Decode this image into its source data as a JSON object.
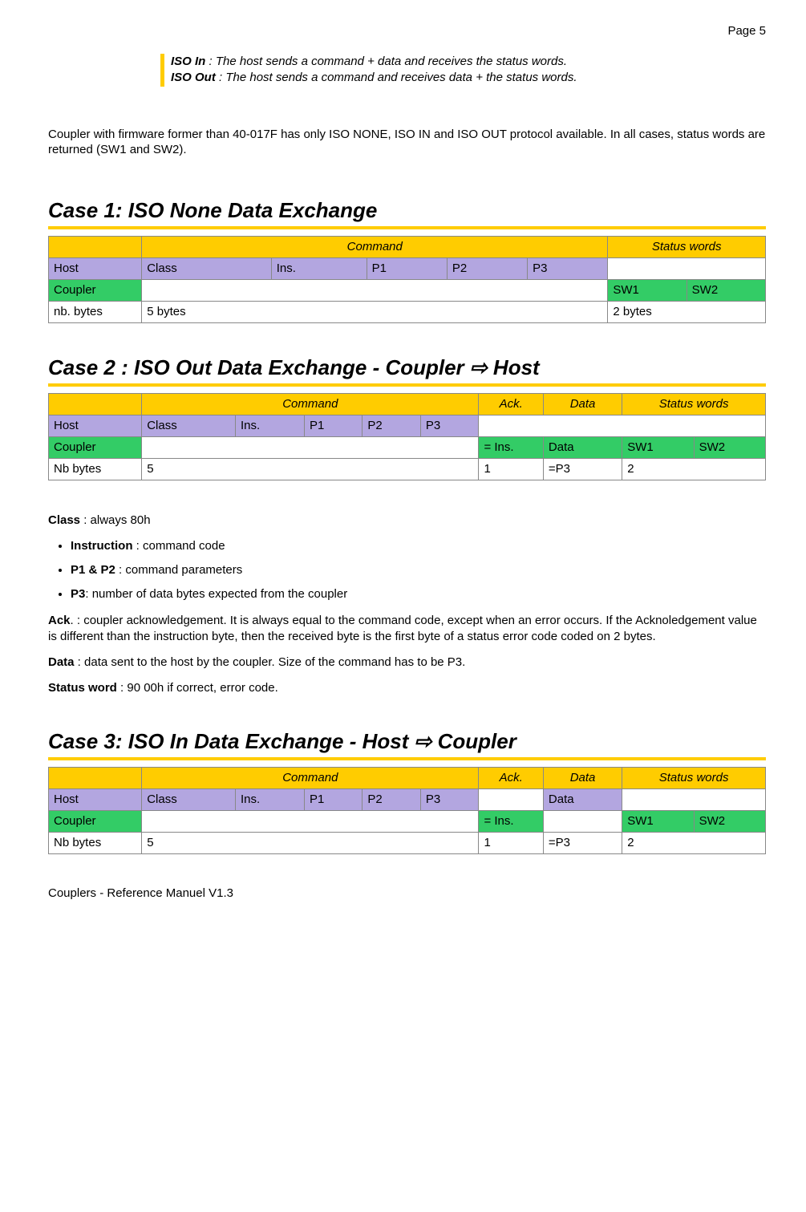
{
  "page_number": "Page 5",
  "note": {
    "iso_in_term": "ISO In",
    "iso_in_text": " : The host sends a command + data and receives the status words.",
    "iso_out_term": "ISO Out",
    "iso_out_text": " : The host sends a command and receives data + the status words."
  },
  "para1": "Coupler with firmware former than 40-017F has only ISO NONE, ISO IN and ISO OUT protocol available. In all cases, status words are returned (SW1 and SW2).",
  "case1": {
    "title": "Case 1: ISO None Data Exchange",
    "hdr_command": "Command",
    "hdr_status": "Status words",
    "host_label": "Host",
    "host_cells": [
      "Class",
      "Ins.",
      "P1",
      "P2",
      "P3"
    ],
    "coupler_label": "Coupler",
    "coupler_cells": [
      "SW1",
      "SW2"
    ],
    "nb_label": "nb. bytes",
    "nb_left": "5 bytes",
    "nb_right": "2 bytes"
  },
  "case2": {
    "title": "Case 2 : ISO Out Data Exchange - Coupler ⇨ Host",
    "hdr_command": "Command",
    "hdr_ack": "Ack.",
    "hdr_data": "Data",
    "hdr_status": "Status words",
    "host_label": "Host",
    "host_cells": [
      "Class",
      "Ins.",
      "P1",
      "P2",
      "P3"
    ],
    "coupler_label": "Coupler",
    "coupler_ack": "= Ins.",
    "coupler_data": "Data",
    "coupler_sw1": "SW1",
    "coupler_sw2": "SW2",
    "nb_label": "Nb bytes",
    "nb_cmd": "5",
    "nb_ack": "1",
    "nb_data": "=P3",
    "nb_status": "2"
  },
  "defs": {
    "class_term": "Class",
    "class_text": " : always 80h",
    "instruction_term": "Instruction",
    "instruction_text": " : command code",
    "p1p2_term": "P1 & P2",
    "p1p2_text": " : command parameters",
    "p3_term": "P3",
    "p3_text": ": number of data bytes expected from the coupler",
    "ack_term": "Ack",
    "ack_text": ". : coupler acknowledgement. It is always equal to the command code, except when an error occurs. If the Acknoledgement value is different than the instruction byte, then the received byte is the first byte of a status error code coded on 2 bytes.",
    "data_term": "Data",
    "data_text": " : data sent to the host by the coupler. Size of the command has to be P3.",
    "sw_term": "Status word",
    "sw_text": " : 90 00h if correct, error code."
  },
  "case3": {
    "title": "Case 3: ISO In Data Exchange - Host ⇨ Coupler",
    "hdr_command": "Command",
    "hdr_ack": "Ack.",
    "hdr_data": "Data",
    "hdr_status": "Status words",
    "host_label": "Host",
    "host_cells": [
      "Class",
      "Ins.",
      "P1",
      "P2",
      "P3"
    ],
    "host_data": "Data",
    "coupler_label": "Coupler",
    "coupler_ack": "= Ins.",
    "coupler_sw1": "SW1",
    "coupler_sw2": "SW2",
    "nb_label": "Nb bytes",
    "nb_cmd": "5",
    "nb_ack": "1",
    "nb_data": "=P3",
    "nb_status": "2"
  },
  "footer": "Couplers - Reference Manuel V1.3"
}
